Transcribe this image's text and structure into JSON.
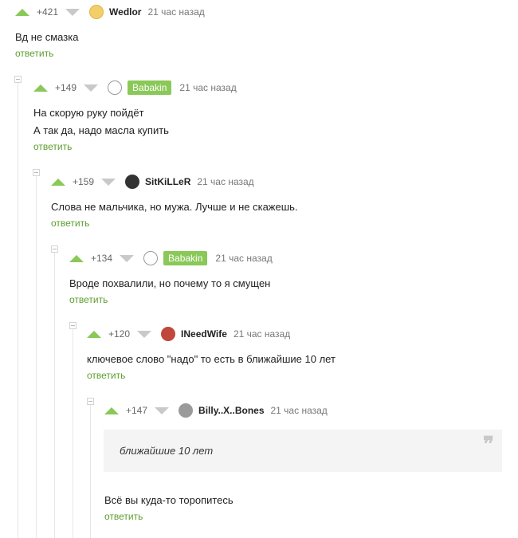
{
  "comments": [
    {
      "rating": "+421",
      "author": "Wedlor",
      "badge": false,
      "time": "21 час назад",
      "lines": [
        "Вд не смазка"
      ],
      "reply": "ответить",
      "avatar_color": "#f3cf6a"
    },
    {
      "rating": "+149",
      "author": "Babakin",
      "badge": true,
      "time": "21 час назад",
      "lines": [
        "На скорую руку пойдёт",
        "А так да, надо масла купить"
      ],
      "reply": "ответить",
      "avatar_color": "#ffffff"
    },
    {
      "rating": "+159",
      "author": "SitKiLLeR",
      "badge": false,
      "time": "21 час назад",
      "lines": [
        "Слова не мальчика, но мужа. Лучше и не скажешь."
      ],
      "reply": "ответить",
      "avatar_color": "#333333"
    },
    {
      "rating": "+134",
      "author": "Babakin",
      "badge": true,
      "time": "21 час назад",
      "lines": [
        "Вроде похвалили, но почему то я смущен"
      ],
      "reply": "ответить",
      "avatar_color": "#ffffff"
    },
    {
      "rating": "+120",
      "author": "INeedWife",
      "badge": false,
      "time": "21 час назад",
      "lines": [
        "ключевое слово \"надо\" то есть в ближайшие 10 лет"
      ],
      "reply": "ответить",
      "avatar_color": "#c0473a"
    },
    {
      "rating": "+147",
      "author": "Billy..X..Bones",
      "badge": false,
      "time": "21 час назад",
      "quote": "ближайшие 10 лет",
      "lines": [
        "Всё вы куда-то торопитесь"
      ],
      "reply": "ответить",
      "avatar_color": "#9a9a9a"
    }
  ],
  "colors": {
    "accent": "#8ac858",
    "reply": "#5c9e2e",
    "downvote": "#c9c9c9"
  }
}
